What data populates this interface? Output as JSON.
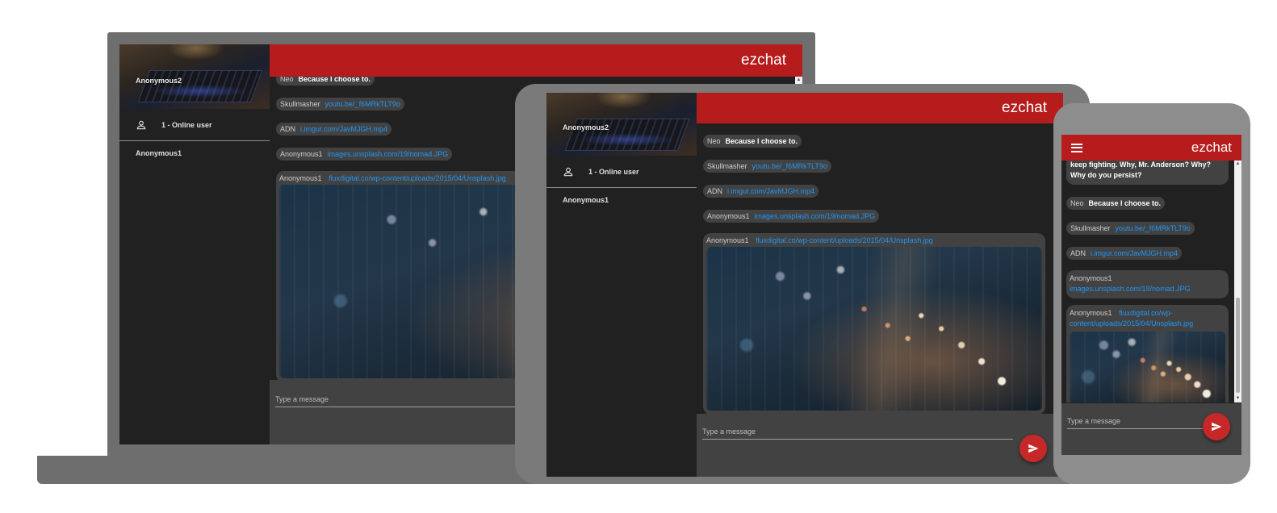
{
  "app": {
    "title": "ezchat"
  },
  "sidebar": {
    "username": "Anonymous2",
    "online_count": "1 - Online user",
    "users": [
      "Anonymous1"
    ]
  },
  "messages": [
    {
      "author": "",
      "text": "keep fighting. Why, Mr. Anderson? Why? Why do you persist?"
    },
    {
      "author": "Neo",
      "text": "Because I choose to."
    },
    {
      "author": "Skullmasher",
      "link": "youtu.be/_f6MRkTLT9o"
    },
    {
      "author": "ADN",
      "link": "i.imgur.com/JavMJGH.mp4"
    },
    {
      "author": "Anonymous1",
      "link": "images.unsplash.com/19/nomad.JPG"
    },
    {
      "author": "Anonymous1",
      "link": "fluxdigital.co/wp-content/uploads/2015/04/Unsplash.jpg"
    }
  ],
  "input": {
    "placeholder": "Type a message"
  },
  "icons": {
    "person": "person-outline-icon",
    "send": "send-icon",
    "menu": "menu-icon"
  },
  "colors": {
    "accent": "#b71c1c",
    "background": "#212121",
    "bubble": "#424242",
    "link": "#2196f3"
  }
}
